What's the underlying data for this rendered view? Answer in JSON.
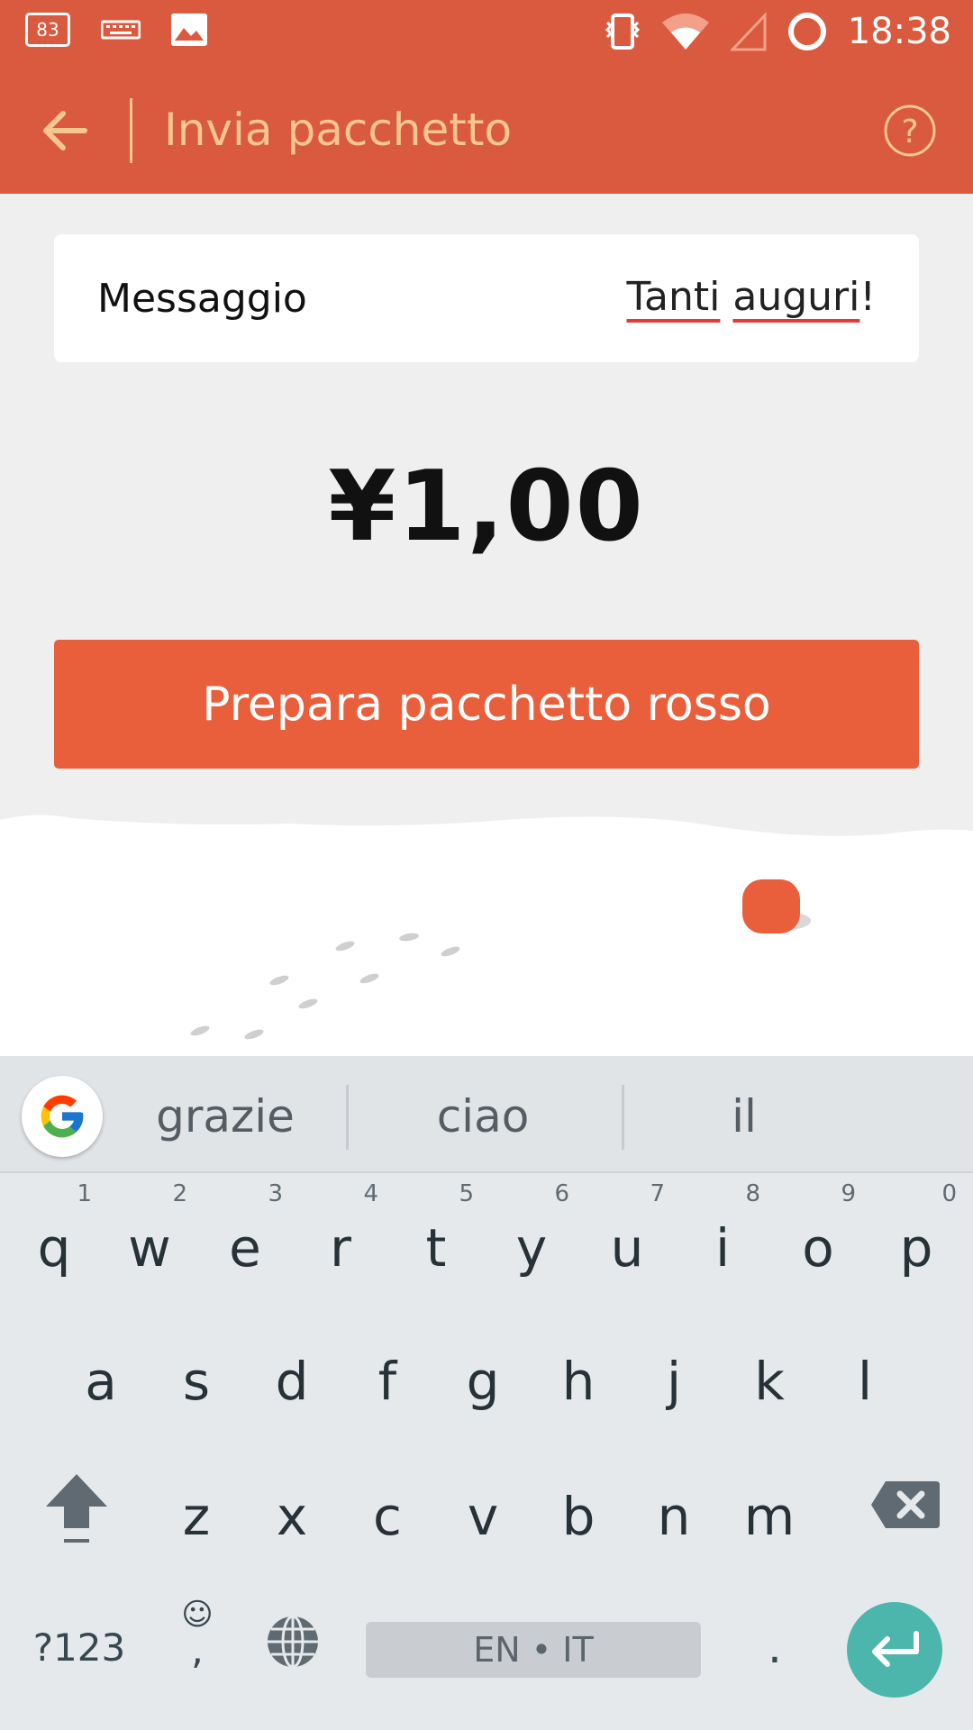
{
  "status_bar": {
    "notification_badge": "83",
    "time": "18:38",
    "icons": [
      "badge-icon",
      "keyboard-icon",
      "image-icon",
      "vibrate-icon",
      "wifi-icon",
      "signal-icon",
      "sync-icon"
    ]
  },
  "app_bar": {
    "title": "Invia pacchetto",
    "back_icon": "arrow-left-icon",
    "help_icon": "help-circle-icon"
  },
  "message": {
    "label": "Messaggio",
    "value_word1": "Tanti",
    "value_word2": "auguri",
    "value_punct": "!"
  },
  "amount": "¥1,00",
  "prepare_button": "Prepara pacchetto rosso",
  "keyboard": {
    "suggestions": [
      "grazie",
      "ciao",
      "il"
    ],
    "row1": [
      {
        "key": "q",
        "hint": "1"
      },
      {
        "key": "w",
        "hint": "2"
      },
      {
        "key": "e",
        "hint": "3"
      },
      {
        "key": "r",
        "hint": "4"
      },
      {
        "key": "t",
        "hint": "5"
      },
      {
        "key": "y",
        "hint": "6"
      },
      {
        "key": "u",
        "hint": "7"
      },
      {
        "key": "i",
        "hint": "8"
      },
      {
        "key": "o",
        "hint": "9"
      },
      {
        "key": "p",
        "hint": "0"
      }
    ],
    "row2": [
      "a",
      "s",
      "d",
      "f",
      "g",
      "h",
      "j",
      "k",
      "l"
    ],
    "row3": [
      "z",
      "x",
      "c",
      "v",
      "b",
      "n",
      "m"
    ],
    "symbols_label": "?123",
    "emoji_label": "☺",
    "comma_label": ",",
    "space_label": "EN • IT",
    "period_label": "."
  },
  "colors": {
    "accent": "#da5a3f",
    "title_text": "#f6c690",
    "button": "#ea5f3b",
    "enter_key": "#4db6ac"
  }
}
